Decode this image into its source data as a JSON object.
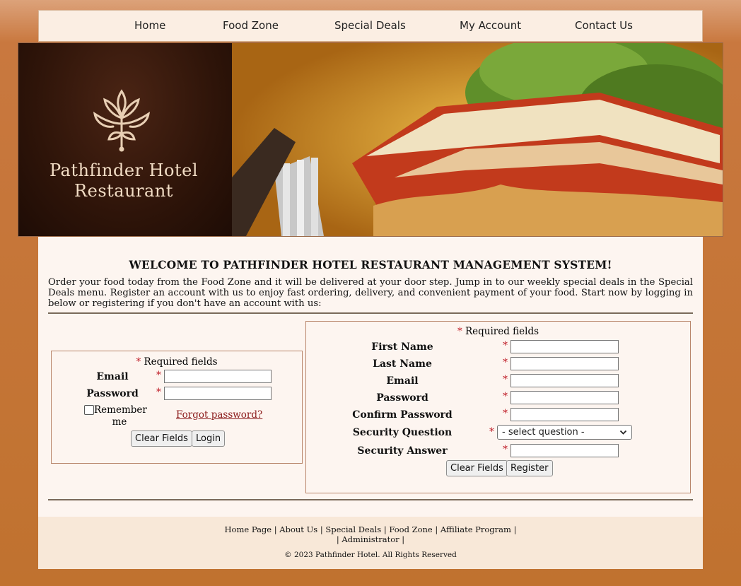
{
  "nav": {
    "items": [
      {
        "label": "Home"
      },
      {
        "label": "Food Zone"
      },
      {
        "label": "Special Deals"
      },
      {
        "label": "My Account"
      },
      {
        "label": "Contact Us"
      }
    ]
  },
  "brand": {
    "line1": "Pathfinder Hotel",
    "line2": "Restaurant"
  },
  "welcome": {
    "heading": "WELCOME TO PATHFINDER HOTEL RESTAURANT MANAGEMENT SYSTEM!",
    "intro": "Order your food today from the Food Zone and it will be delivered at your door step. Jump in to our weekly special deals in the Special Deals menu. Register an account with us to enjoy fast ordering, delivery, and convenient payment of your food. Start now by logging in below or registering if you don't have an account with us:"
  },
  "login": {
    "required_star": "*",
    "required_text": "Required fields",
    "email_label": "Email",
    "password_label": "Password",
    "email_value": "",
    "password_value": "",
    "remember_label": "Remember me",
    "remember_checked": false,
    "forgot_label": "Forgot password?",
    "clear_label": "Clear Fields",
    "login_label": "Login"
  },
  "register": {
    "required_star": "*",
    "required_text": "Required fields",
    "first_name_label": "First Name",
    "last_name_label": "Last Name",
    "email_label": "Email",
    "password_label": "Password",
    "confirm_password_label": "Confirm Password",
    "security_question_label": "Security Question",
    "security_question_selected": "- select question -",
    "security_answer_label": "Security Answer",
    "clear_label": "Clear Fields",
    "register_label": "Register"
  },
  "footer": {
    "links": [
      {
        "label": "Home Page"
      },
      {
        "label": "About Us"
      },
      {
        "label": "Special Deals"
      },
      {
        "label": "Food Zone"
      },
      {
        "label": "Affiliate Program"
      },
      {
        "label": "Administrator"
      }
    ],
    "sep": "|",
    "copyright": "© 2023 Pathfinder Hotel. All Rights Reserved"
  },
  "colors": {
    "page_bg": "#c0722f",
    "nav_bg": "#fbeee3",
    "content_bg": "#fdf5f0",
    "required": "#c0202a",
    "brand_text": "#f1dcc4",
    "forgot_link": "#8b1a1a"
  },
  "icons": {
    "logo": "lily-flower-icon",
    "dropdown": "chevron-down-icon"
  }
}
